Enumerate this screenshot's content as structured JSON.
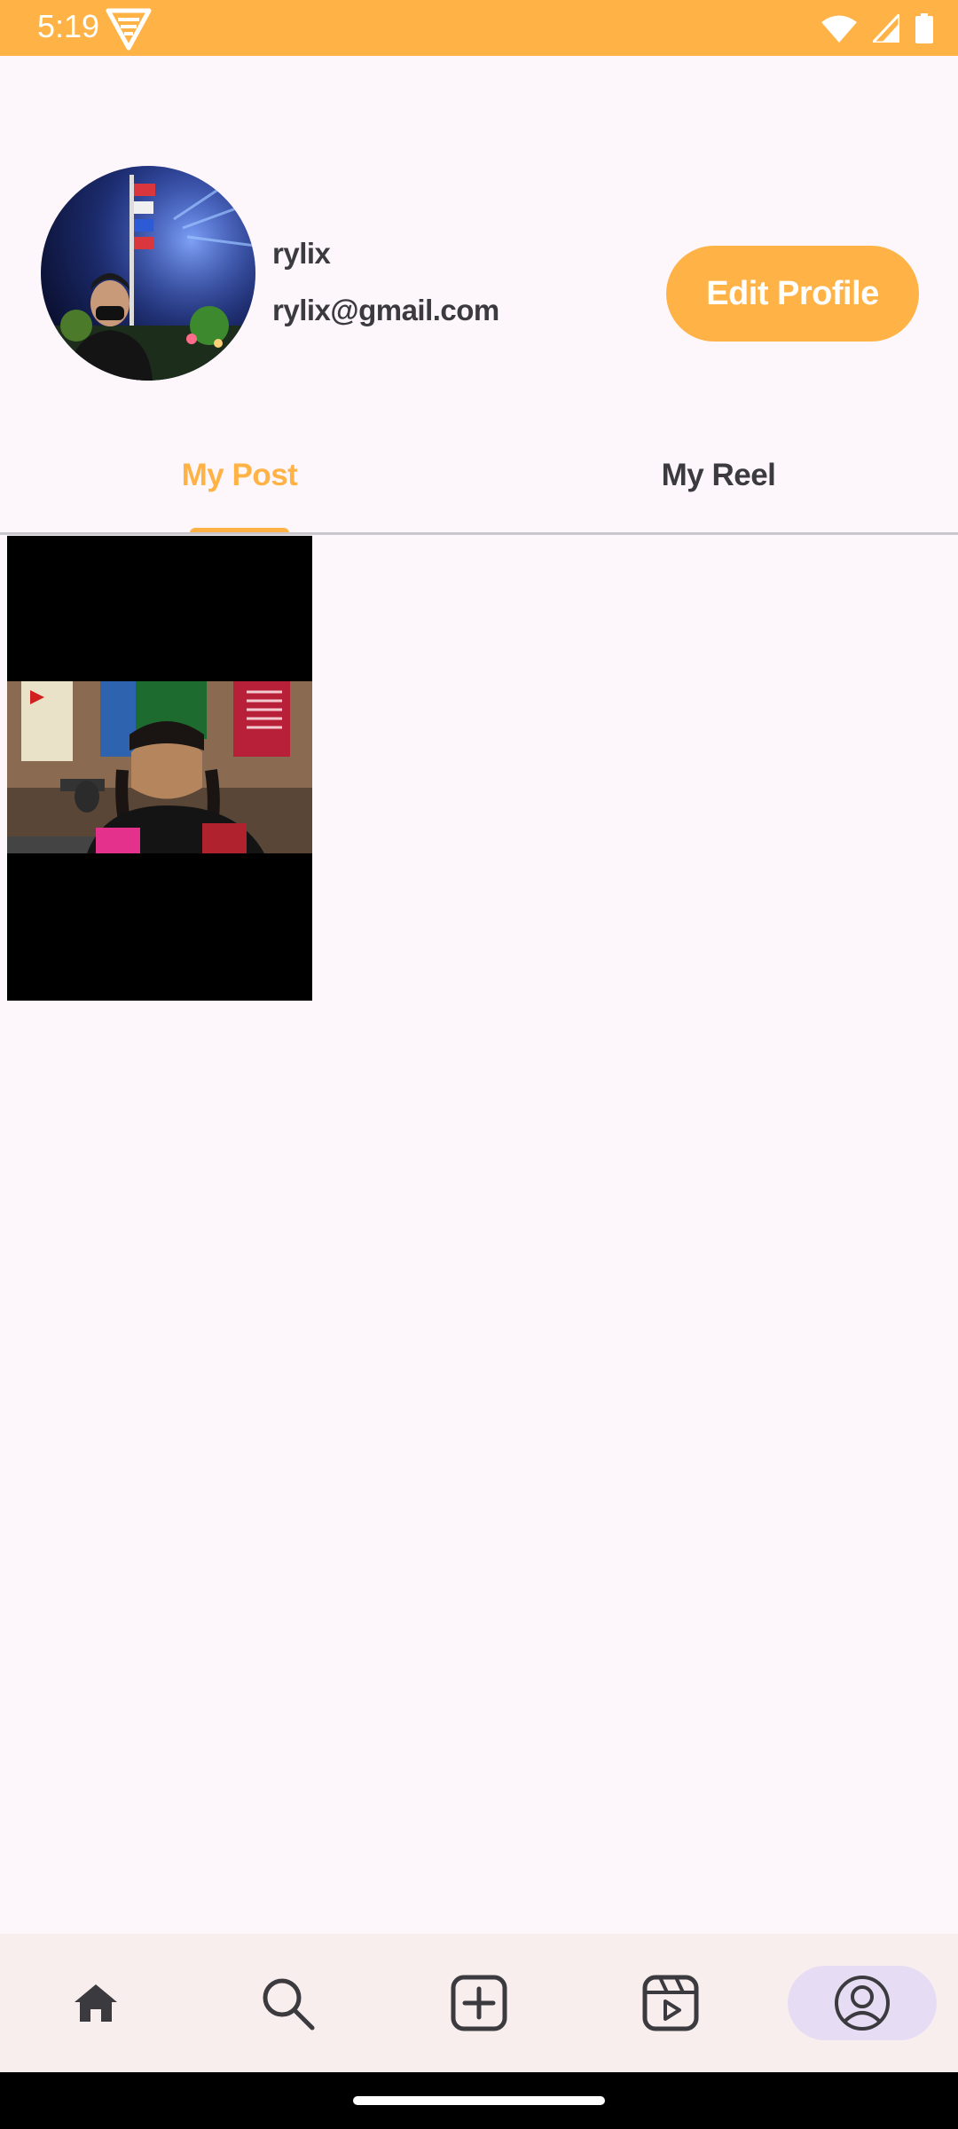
{
  "status_bar": {
    "time": "5:19",
    "icons": [
      "app-logo-icon",
      "wifi-icon",
      "signal-icon",
      "battery-icon"
    ]
  },
  "profile": {
    "username": "rylix",
    "email": "rylix@gmail.com",
    "edit_button_label": "Edit Profile"
  },
  "tabs": [
    {
      "label": "My Post",
      "active": true
    },
    {
      "label": "My Reel",
      "active": false
    }
  ],
  "posts": [
    {
      "type": "video-thumbnail"
    }
  ],
  "bottom_nav": {
    "items": [
      {
        "icon": "home-icon",
        "active": false
      },
      {
        "icon": "search-icon",
        "active": false
      },
      {
        "icon": "add-post-icon",
        "active": false
      },
      {
        "icon": "reels-icon",
        "active": false
      },
      {
        "icon": "profile-icon",
        "active": true
      }
    ]
  },
  "colors": {
    "accent": "#ffb347",
    "background": "#fdf7fc",
    "text": "#3b3a3e",
    "nav_background": "#f9eeee",
    "nav_active_pill": "#e6ddf4"
  }
}
